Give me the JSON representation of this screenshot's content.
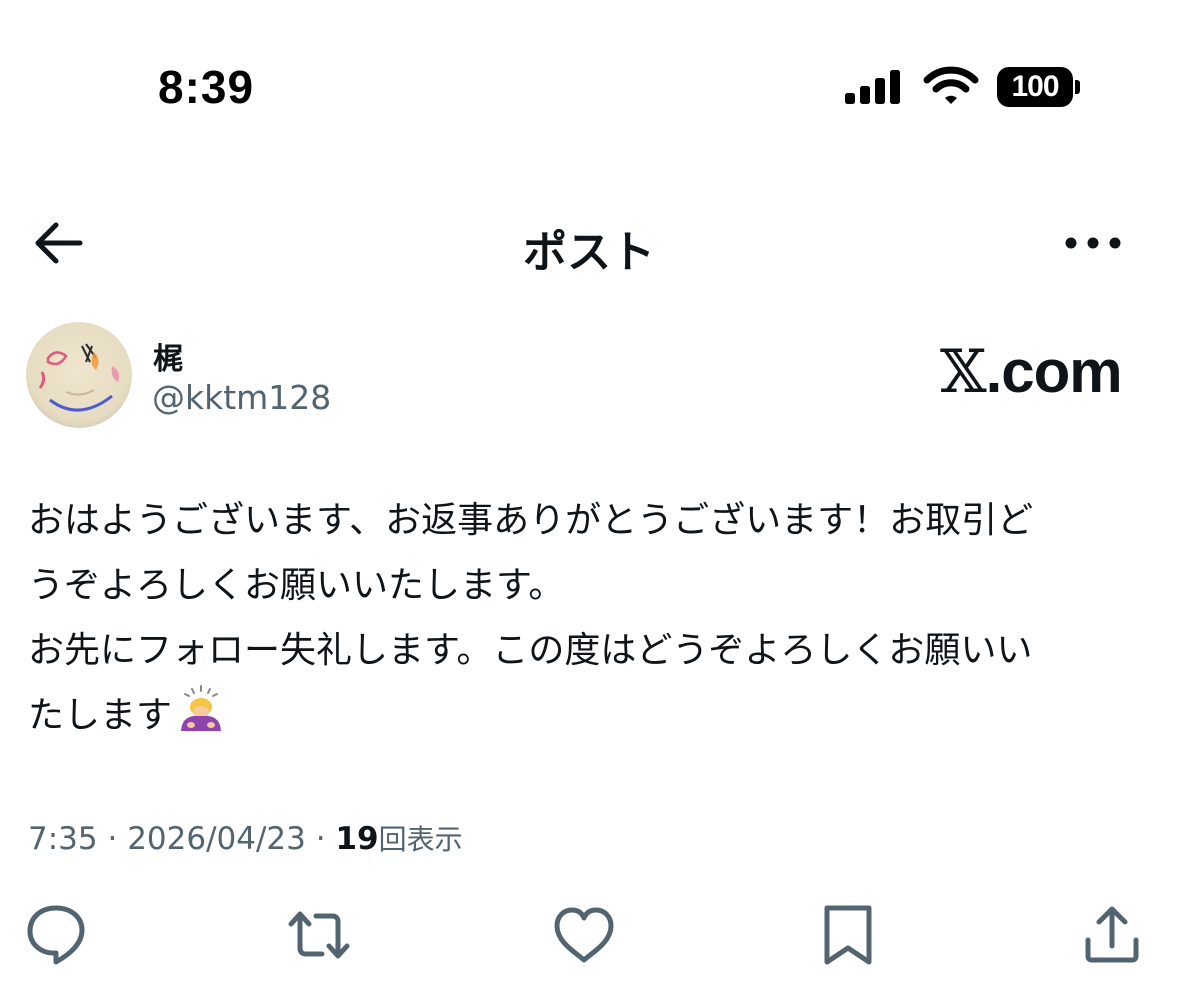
{
  "status_bar": {
    "time": "8:39",
    "battery": "100",
    "icons": [
      "signal-icon",
      "wifi-icon",
      "battery-icon"
    ]
  },
  "header": {
    "title": "ポスト",
    "back_icon": "arrow-left-icon",
    "more_icon": "more-horizontal-icon"
  },
  "author": {
    "display_name": "梶",
    "handle": "@kktm128"
  },
  "watermark": {
    "x": "𝕏",
    "domain": ".com"
  },
  "post": {
    "lines": [
      "おはようございます、お返事ありがとうございます！お取引ど",
      "うぞよろしくお願いいたします。",
      "お先にフォロー失礼します。この度はどうぞよろしくお願いい",
      "たします"
    ],
    "emoji": "person-bowing-emoji"
  },
  "meta": {
    "time": "7:35",
    "date": "2026/04/23",
    "separator": " · ",
    "views_count": "19",
    "views_label": "回表示"
  },
  "actions": {
    "icons": [
      "reply-icon",
      "repost-icon",
      "like-icon",
      "bookmark-icon",
      "share-icon"
    ]
  },
  "colors": {
    "text_primary": "#0f1419",
    "text_secondary": "#536471",
    "background": "#ffffff"
  }
}
